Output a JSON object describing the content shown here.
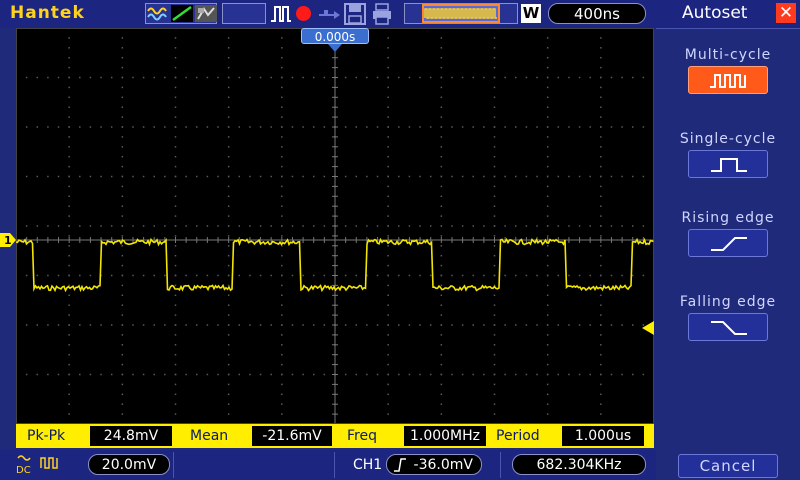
{
  "brand": "Hantek",
  "toolbar": {
    "timebase": "400ns",
    "acq_mode": "W",
    "icons": [
      "fft-wave-icon",
      "ramp-icon",
      "persist-icon",
      "pulse-trigger-icon",
      "run-stop-icon",
      "usb-icon",
      "save-icon",
      "print-icon",
      "waveform-position-icon"
    ]
  },
  "screen": {
    "trigger_time": "0.000s",
    "channel_marker": "1",
    "trace_color": "#f2e600",
    "grid_color": "#5a5a5a"
  },
  "measurements": {
    "pkpk_label": "Pk-Pk",
    "pkpk_value": "24.8mV",
    "mean_label": "Mean",
    "mean_value": "-21.6mV",
    "freq_label": "Freq",
    "freq_value": "1.000MHz",
    "period_label": "Period",
    "period_value": "1.000us"
  },
  "status": {
    "coupling": "DC",
    "volts_div": "20.0mV",
    "trigger_source": "CH1",
    "trigger_level": "-36.0mV",
    "trigger_freq": "682.304KHz"
  },
  "autoset_panel": {
    "title": "Autoset",
    "options": [
      {
        "label": "Multi-cycle",
        "icon": "multi-cycle-wave-icon",
        "active": true
      },
      {
        "label": "Single-cycle",
        "icon": "single-pulse-icon",
        "active": false
      },
      {
        "label": "Rising edge",
        "icon": "rising-edge-icon",
        "active": false
      },
      {
        "label": "Falling edge",
        "icon": "falling-edge-icon",
        "active": false
      }
    ],
    "cancel_label": "Cancel"
  }
}
